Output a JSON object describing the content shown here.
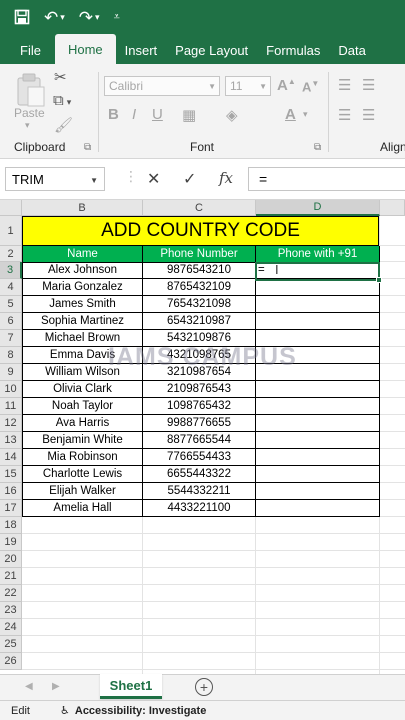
{
  "tabs": [
    "File",
    "Home",
    "Insert",
    "Page Layout",
    "Formulas",
    "Data"
  ],
  "active_tab": "Home",
  "ribbon": {
    "paste_label": "Paste",
    "clipboard_label": "Clipboard",
    "font_label": "Font",
    "alignment_label": "Align",
    "font_name": "Calibri",
    "font_size": "11"
  },
  "formula_bar": {
    "name_box": "TRIM",
    "formula": "="
  },
  "columns": [
    "B",
    "C",
    "D"
  ],
  "row_numbers": [
    "1",
    "2",
    "3",
    "4",
    "5",
    "6",
    "7",
    "8",
    "9",
    "10",
    "11",
    "12",
    "13",
    "14",
    "15",
    "16",
    "17",
    "18",
    "19",
    "20",
    "21",
    "22",
    "23",
    "24",
    "25",
    "26"
  ],
  "sheet": {
    "title": "ADD COUNTRY CODE",
    "headers": [
      "Name",
      "Phone Number",
      "Phone with +91"
    ],
    "active_cell_value": "=",
    "rows": [
      [
        "Alex Johnson",
        "9876543210"
      ],
      [
        "Maria Gonzalez",
        "8765432109"
      ],
      [
        "James Smith",
        "7654321098"
      ],
      [
        "Sophia Martinez",
        "6543210987"
      ],
      [
        "Michael Brown",
        "5432109876"
      ],
      [
        "Emma Davis",
        "4321098765"
      ],
      [
        "William Wilson",
        "3210987654"
      ],
      [
        "Olivia Clark",
        "2109876543"
      ],
      [
        "Noah Taylor",
        "1098765432"
      ],
      [
        "Ava Harris",
        "9988776655"
      ],
      [
        "Benjamin White",
        "8877665544"
      ],
      [
        "Mia Robinson",
        "7766554433"
      ],
      [
        "Charlotte Lewis",
        "6655443322"
      ],
      [
        "Elijah Walker",
        "5544332211"
      ],
      [
        "Amelia Hall",
        "4433221100"
      ]
    ]
  },
  "watermark": "IAMS CAMPUS",
  "sheet_tab": "Sheet1",
  "status": {
    "mode": "Edit",
    "accessibility": "Accessibility: Investigate"
  },
  "colors": {
    "excel_green": "#1f7145",
    "title_fill": "#ffff00",
    "header_fill": "#00b050"
  },
  "icons": [
    "save-icon",
    "undo-icon",
    "redo-icon",
    "customize-icon",
    "cut-icon",
    "copy-icon",
    "format-painter-icon",
    "increase-font-icon",
    "decrease-font-icon",
    "cancel-icon",
    "enter-icon",
    "fx-icon",
    "add-sheet-icon",
    "accessibility-icon"
  ]
}
